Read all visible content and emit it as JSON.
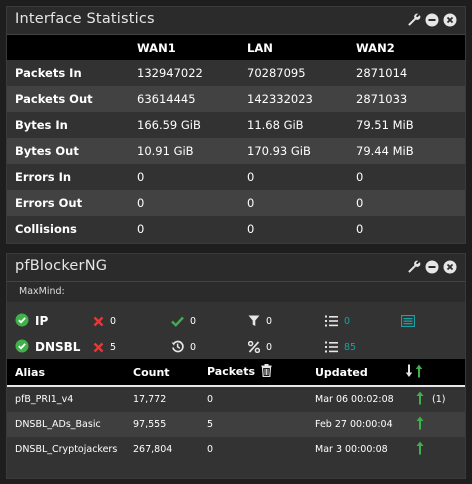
{
  "interface_widget": {
    "title": "Interface Statistics",
    "columns": [
      "",
      "WAN1",
      "LAN",
      "WAN2"
    ],
    "rows": [
      {
        "label": "Packets In",
        "values": [
          "132947022",
          "70287095",
          "2871014"
        ]
      },
      {
        "label": "Packets Out",
        "values": [
          "63614445",
          "142332023",
          "2871033"
        ]
      },
      {
        "label": "Bytes In",
        "values": [
          "166.59 GiB",
          "11.68 GiB",
          "79.51 MiB"
        ]
      },
      {
        "label": "Bytes Out",
        "values": [
          "10.91 GiB",
          "170.93 GiB",
          "79.44 MiB"
        ]
      },
      {
        "label": "Errors In",
        "values": [
          "0",
          "0",
          "0"
        ]
      },
      {
        "label": "Errors Out",
        "values": [
          "0",
          "0",
          "0"
        ]
      },
      {
        "label": "Collisions",
        "values": [
          "0",
          "0",
          "0"
        ]
      }
    ]
  },
  "pfblocker_widget": {
    "title": "pfBlockerNG",
    "maxmind": "MaxMind:",
    "ip": {
      "label": "IP",
      "blocked": "0",
      "permitted": "0",
      "filter": "0",
      "list_count": "0"
    },
    "dnsbl": {
      "label": "DNSBL",
      "blocked": "5",
      "history": "0",
      "percent": "0",
      "list_count": "85"
    },
    "table": {
      "headers": {
        "alias": "Alias",
        "count": "Count",
        "packets": "Packets",
        "updated": "Updated"
      },
      "rows": [
        {
          "alias": "pfB_PRI1_v4",
          "count": "17,772",
          "packets": "0",
          "updated": "Mar 06 00:02:08",
          "extra": "(1)"
        },
        {
          "alias": "DNSBL_ADs_Basic",
          "count": "97,555",
          "packets": "5",
          "updated": "Feb 27 00:00:04",
          "extra": ""
        },
        {
          "alias": "DNSBL_Cryptojackers",
          "count": "267,804",
          "packets": "0",
          "updated": "Mar 3 00:00:08",
          "extra": ""
        }
      ]
    }
  },
  "colors": {
    "green": "#3fb04a",
    "red": "#e03a3a",
    "teal": "#1ba1a1"
  }
}
